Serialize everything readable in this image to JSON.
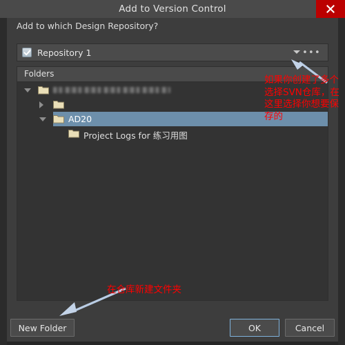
{
  "window": {
    "title": "Add to Version Control",
    "close_icon": "close-icon"
  },
  "dialog": {
    "prompt": "Add to which Design Repository?"
  },
  "repository_combo": {
    "checked": true,
    "value": "Repository 1",
    "caret_icon": "chevron-down-icon",
    "more_icon": "ellipsis-icon"
  },
  "folders_panel": {
    "header": "Folders",
    "rows": [
      {
        "label": "",
        "redacted": true,
        "depth": 0,
        "expander": "expanded",
        "selected": false
      },
      {
        "label": "",
        "redacted": true,
        "depth": 1,
        "expander": "collapsed",
        "selected": false
      },
      {
        "label": "AD20",
        "redacted": false,
        "depth": 1,
        "expander": "expanded",
        "selected": true
      },
      {
        "label": "Project Logs for 练习用图",
        "redacted": false,
        "depth": 2,
        "expander": "none",
        "selected": false
      }
    ]
  },
  "buttons": {
    "new_folder": "New Folder",
    "ok": "OK",
    "cancel": "Cancel"
  },
  "annotations": {
    "repository": "如果你创建了多个选择SVN仓库，在这里选择你想要保存的",
    "new_folder": "在仓库新建文件夹"
  },
  "colors": {
    "close_red": "#bb0000",
    "annotation_red": "#ff0000",
    "selection_blue": "#6d8fab",
    "arrow_blue": "#b9cce4",
    "titlebar": "#4a4a4a",
    "dialog_bg": "#3d3d3d",
    "panel_bg": "#333333",
    "focus_border": "#7fb3dd"
  }
}
